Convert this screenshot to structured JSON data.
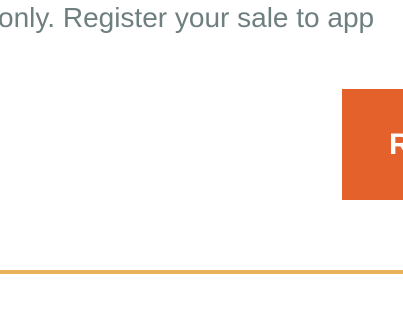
{
  "content": {
    "intro_text": "only. Register your sale to app"
  },
  "register_button": {
    "label": "R"
  },
  "colors": {
    "text": "#6f7f80",
    "button_background": "#e5612c",
    "button_text": "#ffffff",
    "divider": "#e9b35c"
  }
}
